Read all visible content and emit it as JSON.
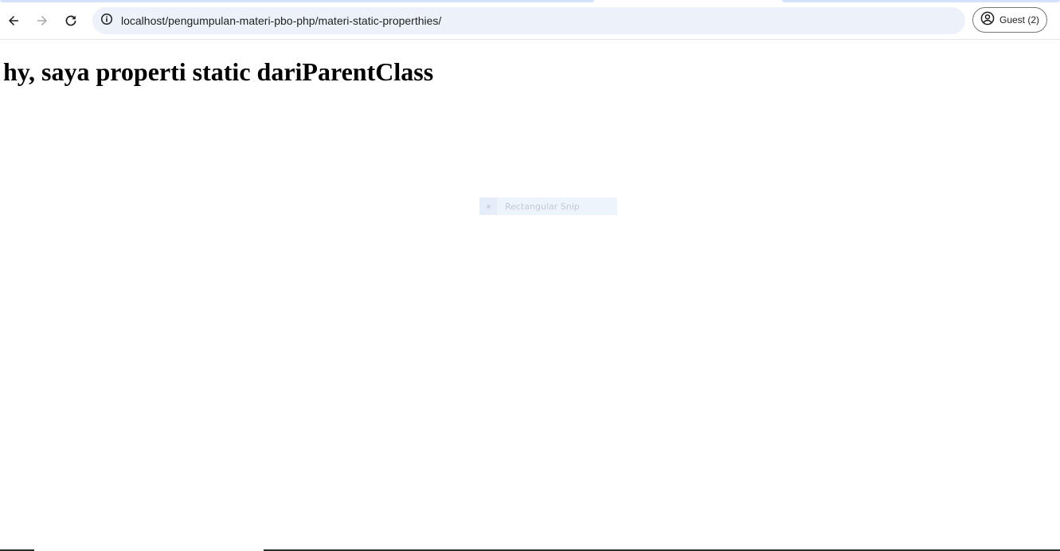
{
  "browser": {
    "address_bar": {
      "url": "localhost/pengumpulan-materi-pbo-php/materi-static-properthies/"
    },
    "profile": {
      "label": "Guest (2)"
    },
    "icons": {
      "back": "arrow-left-icon",
      "forward": "arrow-right-icon",
      "reload": "reload-icon",
      "site_info": "info-icon",
      "profile": "account-circle-icon"
    }
  },
  "page": {
    "heading": "hy, saya properti static dariParentClass"
  },
  "overlay": {
    "snip_mode_label": "Rectangular Snip"
  },
  "colors": {
    "omnibox_bg": "#edf2fa",
    "tab_accent": "#d3e3fd",
    "text": "#1f1f1f",
    "disabled_icon": "#a8a8a8"
  }
}
